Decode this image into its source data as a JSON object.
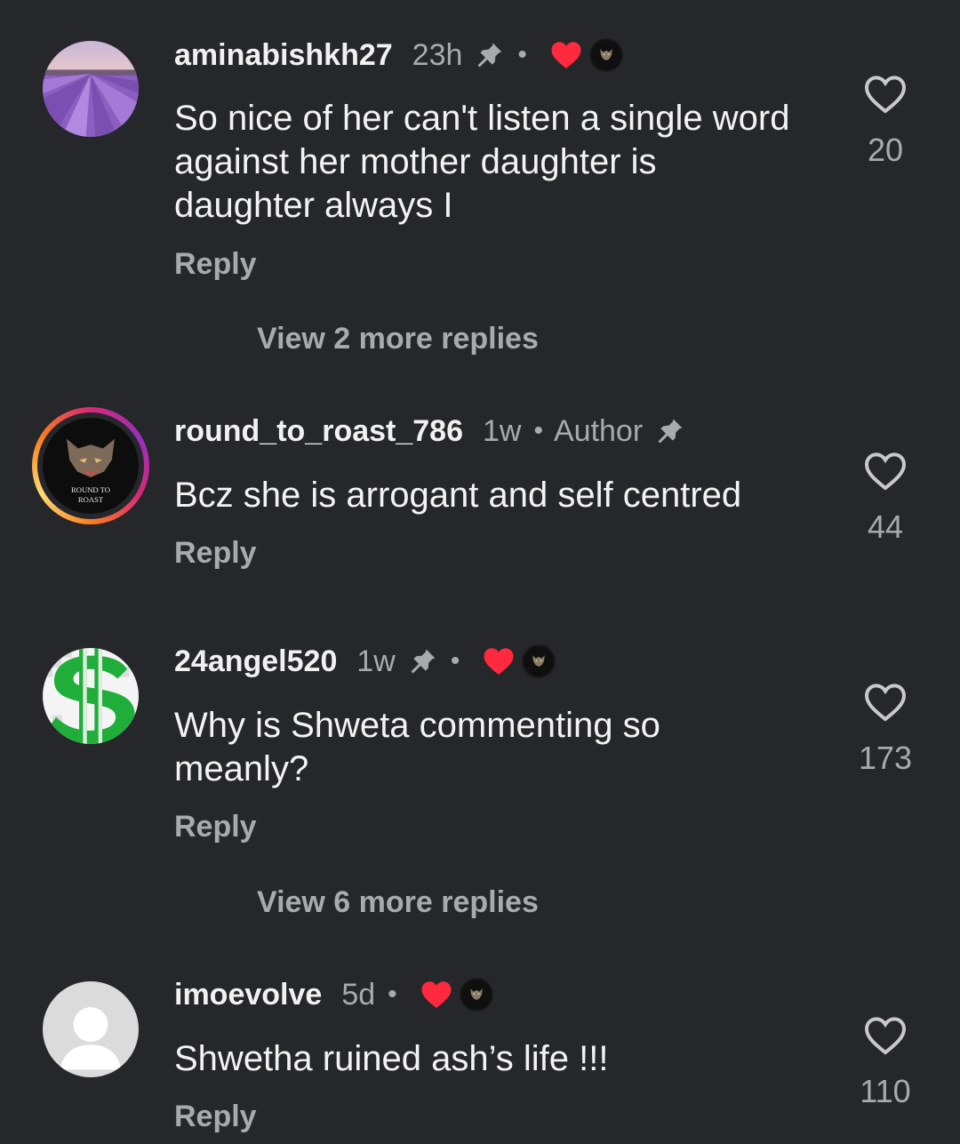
{
  "comments": [
    {
      "username": "aminabishkh27",
      "time": "23h",
      "dot": "•",
      "text": "So nice of her can't listen a single word against her mother daughter is daughter always I",
      "reply": "Reply",
      "likes": "20",
      "view_more": "View 2 more replies",
      "avatar": "lavender-field-avatar",
      "pinned": true,
      "liked_by_author": true
    },
    {
      "username": "round_to_roast_786",
      "time": "1w",
      "dot": "•",
      "author_label": "Author",
      "text": "Bcz she is arrogant and self centred",
      "reply": "Reply",
      "likes": "44",
      "avatar": "tiger-logo-avatar",
      "avatar_text_1": "ROUND TO",
      "avatar_text_2": "ROAST",
      "pinned": true
    },
    {
      "username": "24angel520",
      "time": "1w",
      "dot": "•",
      "text": "Why is Shweta commenting so meanly?",
      "reply": "Reply",
      "likes": "173",
      "view_more": "View 6 more replies",
      "avatar": "dollar-sign-avatar",
      "pinned": true,
      "liked_by_author": true
    },
    {
      "username": "imoevolve",
      "time": "5d",
      "dot": "•",
      "text": "Shwetha ruined ash’s life !!!",
      "reply": "Reply",
      "likes": "110",
      "avatar": "default-user-avatar",
      "liked_by_author": true
    }
  ],
  "colors": {
    "background": "#26272b",
    "heart_red": "#ff2a3d",
    "muted_text": "#a9aaad",
    "dollar_green": "#1fae3a"
  }
}
